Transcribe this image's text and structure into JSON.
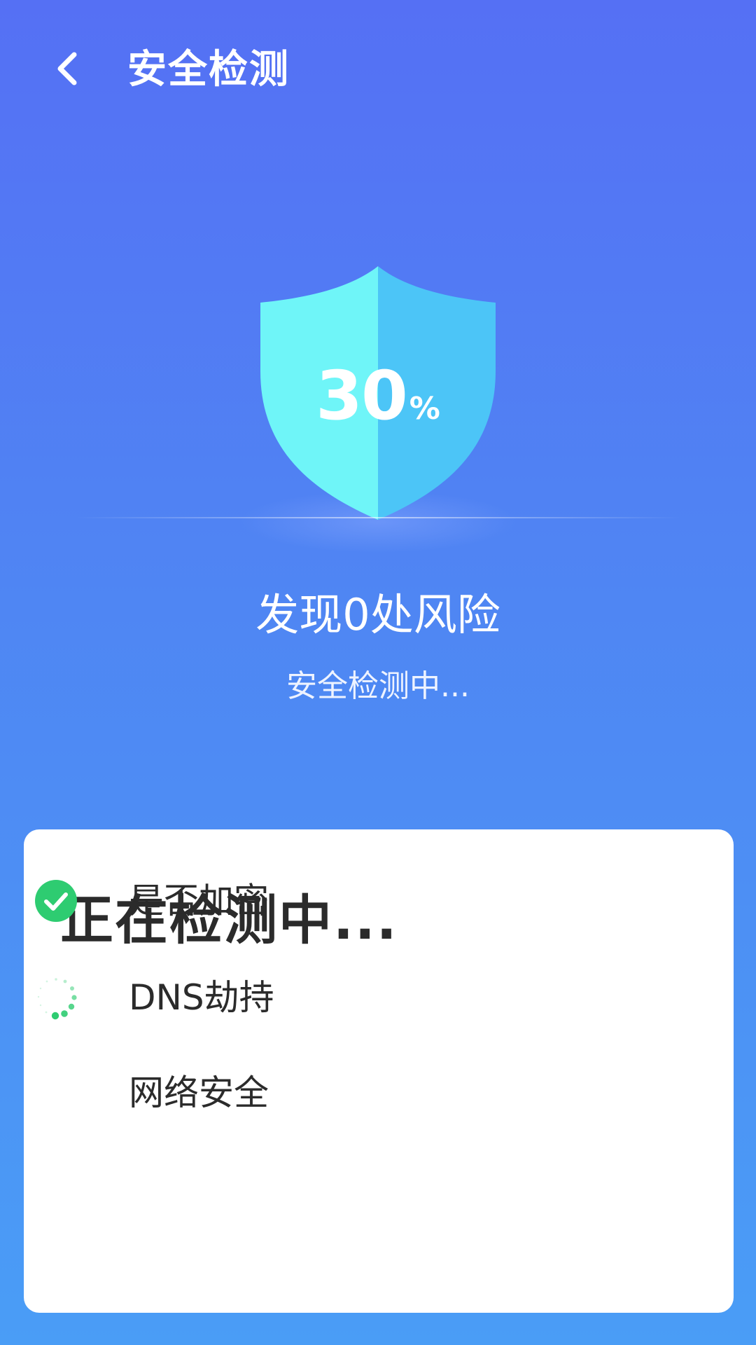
{
  "header": {
    "back_icon": "chevron-left-icon",
    "title": "安全检测"
  },
  "shield": {
    "progress_value": "30",
    "progress_unit": "%",
    "progress_fraction": 0.3,
    "icon": "shield-icon",
    "colors": {
      "left_half": "#6ff5f8",
      "right_half": "#4cc5f7"
    }
  },
  "summary": {
    "risk_text": "发现0处风险",
    "status_text": "安全检测中..."
  },
  "card": {
    "title": "正在检测中...",
    "items": [
      {
        "label": "是否加密",
        "state": "done",
        "icon": "check-circle-icon"
      },
      {
        "label": "DNS劫持",
        "state": "in-progress",
        "icon": "loading-spinner-icon"
      },
      {
        "label": "网络安全",
        "state": "pending",
        "icon": ""
      }
    ]
  },
  "colors": {
    "background_top": "#5570f4",
    "background_bottom": "#4a9df6",
    "success_green": "#2ecc71",
    "text_dark": "#2b2b2b",
    "card": "#ffffff"
  }
}
